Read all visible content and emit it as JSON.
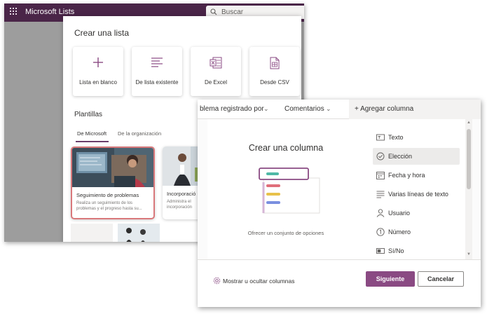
{
  "app": {
    "title": "Microsoft Lists",
    "search_placeholder": "Buscar"
  },
  "create_list": {
    "title": "Crear una lista",
    "cards": [
      {
        "label": "Lista en blanco",
        "icon": "plus-icon"
      },
      {
        "label": "De lista existente",
        "icon": "list-lines-icon"
      },
      {
        "label": "De Excel",
        "icon": "excel-icon"
      },
      {
        "label": "Desde CSV",
        "icon": "csv-icon"
      }
    ],
    "templates_title": "Plantillas",
    "tabs": [
      "De Microsoft",
      "De la organización"
    ],
    "templates": [
      {
        "title": "Seguimiento de problemas",
        "description_lines": [
          "Realiza un seguimiento de los",
          "problemas y el progreso hasta su..."
        ]
      },
      {
        "title": "Incorporació",
        "description_lines": [
          "Administra el",
          "incorporación"
        ]
      }
    ]
  },
  "column_header": {
    "col1": "blema registrado por",
    "col2": "Comentarios",
    "add_column": "+ Agregar columna"
  },
  "create_column": {
    "title": "Crear una columna",
    "subtitle": "Ofrecer un conjunto de opciones",
    "types": [
      {
        "label": "Texto",
        "icon": "text-icon"
      },
      {
        "label": "Elección",
        "icon": "choice-icon"
      },
      {
        "label": "Fecha y hora",
        "icon": "calendar-icon"
      },
      {
        "label": "Varias líneas de texto",
        "icon": "multiline-icon"
      },
      {
        "label": "Usuario",
        "icon": "person-icon"
      },
      {
        "label": "Número",
        "icon": "number-icon"
      },
      {
        "label": "Sí/No",
        "icon": "yesno-icon"
      }
    ],
    "selected_type": "Elección",
    "show_hide": "Mostrar u ocultar columnas",
    "next_button": "Siguiente",
    "cancel_button": "Cancelar"
  },
  "colors": {
    "brand_bar": "#4a2548",
    "accent": "#8a4a83",
    "highlight": "#d9787b"
  }
}
